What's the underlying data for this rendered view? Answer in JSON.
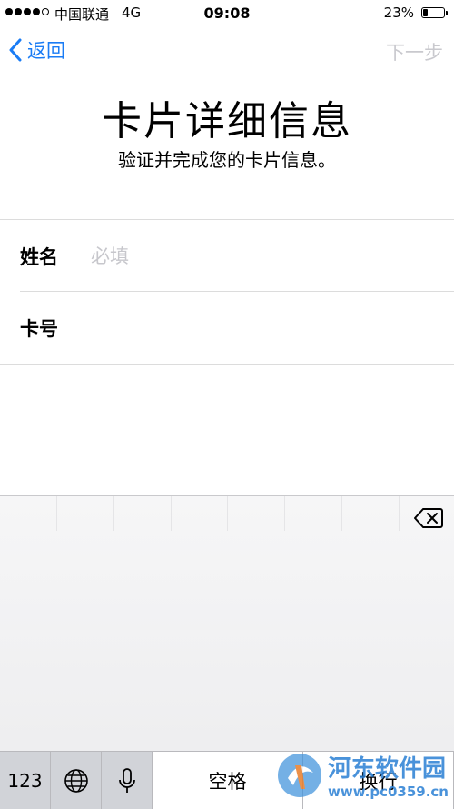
{
  "status_bar": {
    "carrier": "中国联通",
    "network": "4G",
    "time": "09:08",
    "battery_percent": "23%",
    "battery_level": 0.23
  },
  "nav": {
    "back_label": "返回",
    "next_label": "下一步"
  },
  "header": {
    "title": "卡片详细信息",
    "subtitle": "验证并完成您的卡片信息。"
  },
  "form": {
    "name_label": "姓名",
    "name_placeholder": "必填",
    "name_value": "",
    "card_label": "卡号",
    "card_value": ""
  },
  "keyboard": {
    "numbers_key": "123",
    "space_key": "空格",
    "return_key": "换行"
  },
  "watermark": {
    "name": "河东软件园",
    "url": "www.pc0359.cn"
  },
  "colors": {
    "accent": "#1a7cf5",
    "disabled": "#c9c9ce"
  }
}
